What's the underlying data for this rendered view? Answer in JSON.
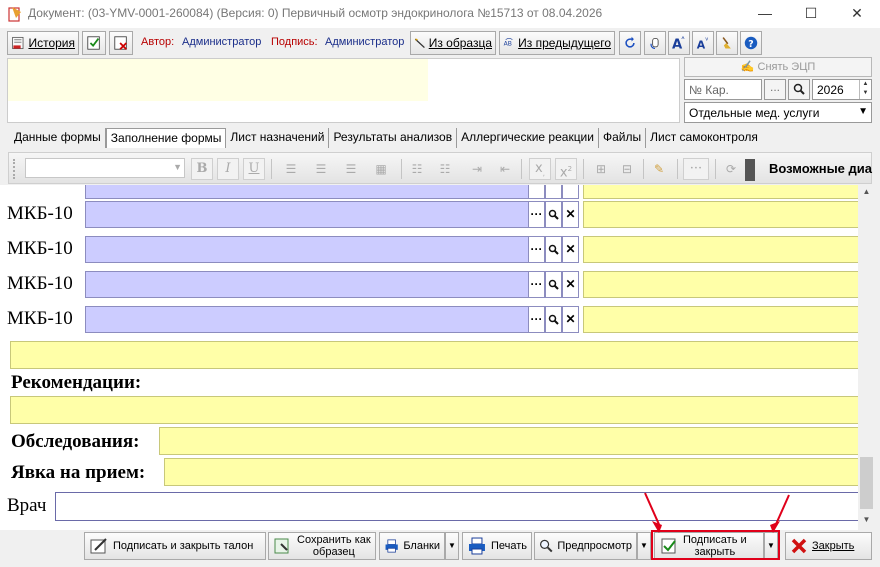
{
  "window": {
    "title": "Документ: (03-YMV-0001-260084) (Версия: 0) Первичный осмотр эндокринолога №15713 от 08.04.2026",
    "minimize": "—",
    "maximize": "☐",
    "close": "✕"
  },
  "toolbar": {
    "history_label": "История",
    "author_label": "Автор:",
    "author_value": "Администратор",
    "signature_label": "Подпись:",
    "signature_value": "Администратор",
    "from_template_label": "Из образца",
    "from_previous_label": "Из предыдущего"
  },
  "header": {
    "remove_ecp_label": "Снять ЭЦП",
    "card_placeholder": "№ Кар.",
    "card_button": "...",
    "year_value": "2026",
    "service_value": "Отдельные мед. услуги"
  },
  "tabs": [
    {
      "label": "Данные формы"
    },
    {
      "label": "Заполнение формы"
    },
    {
      "label": "Лист назначений"
    },
    {
      "label": "Результаты анализов"
    },
    {
      "label": "Аллергические реакции"
    },
    {
      "label": "Файлы"
    },
    {
      "label": "Лист самоконтроля"
    }
  ],
  "format_toolbar": {
    "bold": "B",
    "italic": "I",
    "underline": "U",
    "subscript": "x",
    "superscript": "x",
    "possible_label": "Возможные диа"
  },
  "form": {
    "mkb_rows": [
      {
        "label": "МКБ-10"
      },
      {
        "label": "МКБ-10"
      },
      {
        "label": "МКБ-10"
      },
      {
        "label": "МКБ-10"
      }
    ],
    "mkb_ellipsis": "···",
    "mkb_clear": "✕",
    "recommendations_label": "Рекомендации:",
    "examinations_label": "Обследования:",
    "appointment_label": "Явка на прием:",
    "doctor_label": "Врач"
  },
  "bottom": {
    "sign_close_ticket": "Подписать и закрыть талон",
    "save_as_template_1": "Сохранить как",
    "save_as_template_2": "образец",
    "forms_label": "Бланки",
    "print_label": "Печать",
    "preview_label": "Предпросмотр",
    "sign_close_1": "Подписать и",
    "sign_close_2": "закрыть",
    "close_label": "Закрыть"
  },
  "colors": {
    "field_lavender": "#ccccff",
    "field_yellow": "#ffffa8",
    "highlight_red": "#e0001a"
  }
}
